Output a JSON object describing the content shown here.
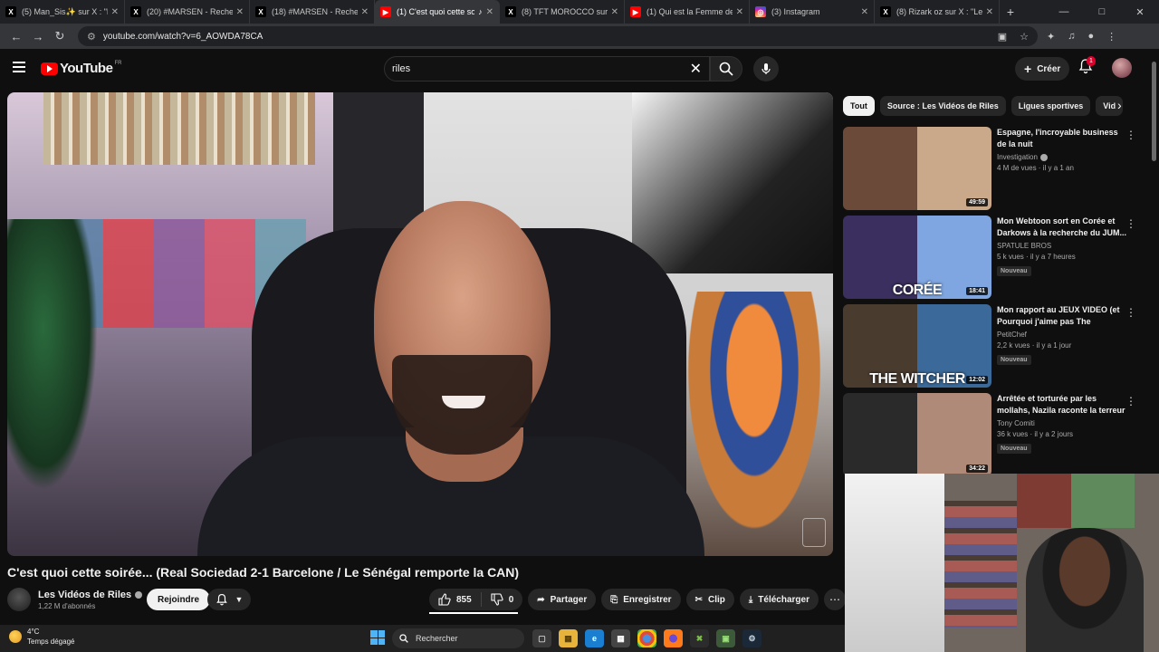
{
  "browser": {
    "tabs": [
      {
        "title": "(5) Man_Sis✨ sur X : \"L'ai",
        "icon": "x-logo-icon",
        "active": false
      },
      {
        "title": "(20) #MARSEN - Recherche",
        "icon": "x-logo-icon",
        "active": false
      },
      {
        "title": "(18) #MARSEN - Recherche",
        "icon": "x-logo-icon",
        "active": false
      },
      {
        "title": "(1) C'est quoi cette soi",
        "icon": "youtube-icon",
        "active": true
      },
      {
        "title": "(8) TFT MOROCCO sur X",
        "icon": "x-logo-icon",
        "active": false
      },
      {
        "title": "(1) Qui est la Femme de S",
        "icon": "youtube-icon",
        "active": false
      },
      {
        "title": "(3) Instagram",
        "icon": "instagram-icon",
        "active": false
      },
      {
        "title": "(8) Rizark oz sur X : \"Le S",
        "icon": "x-logo-icon",
        "active": false
      }
    ],
    "url": "youtube.com/watch?v=6_AOWDA78CA"
  },
  "header": {
    "logo_text": "YouTube",
    "logo_region": "FR",
    "search_value": "riles",
    "create_label": "Créer",
    "notif_count": "1"
  },
  "video": {
    "title": "C'est quoi cette soirée... (Real Sociedad 2-1 Barcelone / Le Sénégal remporte la CAN)",
    "channel_name": "Les Vidéos de Riles",
    "subscribers": "1,22 M d'abonnés",
    "join_label": "Rejoindre",
    "likes": "855",
    "dislikes": "0",
    "share_label": "Partager",
    "save_label": "Enregistrer",
    "clip_label": "Clip",
    "download_label": "Télécharger"
  },
  "chips": [
    "Tout",
    "Source : Les Vidéos de Riles",
    "Ligues sportives",
    "Vid"
  ],
  "recommendations": [
    {
      "title": "Espagne, l'incroyable business de la nuit",
      "channel": "Investigation",
      "verified": true,
      "meta": "4 M de vues · il y a 1 an",
      "duration": "49:59",
      "badge": "",
      "overlay": "",
      "colors": [
        "#6b4a3a",
        "#c9a98a"
      ]
    },
    {
      "title": "Mon Webtoon sort en Corée et Darkows à la recherche du JUM...",
      "channel": "SPATULE BROS",
      "verified": false,
      "meta": "5 k vues · il y a 7 heures",
      "duration": "18:41",
      "badge": "Nouveau",
      "overlay": "CORÉE",
      "colors": [
        "#3a2f5e",
        "#7fa6e0"
      ]
    },
    {
      "title": "Mon rapport au JEUX VIDEO (et Pourquoi j'aime pas The Witcher...",
      "channel": "PetitChef",
      "verified": false,
      "meta": "2,2 k vues · il y a 1 jour",
      "duration": "12:02",
      "badge": "Nouveau",
      "overlay": "THE WITCHER",
      "colors": [
        "#4a3b2f",
        "#3b6a9a"
      ]
    },
    {
      "title": "Arrêtée et torturée par les mollahs, Nazila raconte la terreur",
      "channel": "Tony Comiti",
      "verified": false,
      "meta": "36 k vues · il y a 2 jours",
      "duration": "34:22",
      "badge": "Nouveau",
      "overlay": "",
      "colors": [
        "#2a2a2a",
        "#b08a78"
      ]
    }
  ],
  "taskbar": {
    "temp": "4°C",
    "weather": "Temps dégagé",
    "search_label": "Rechercher"
  }
}
